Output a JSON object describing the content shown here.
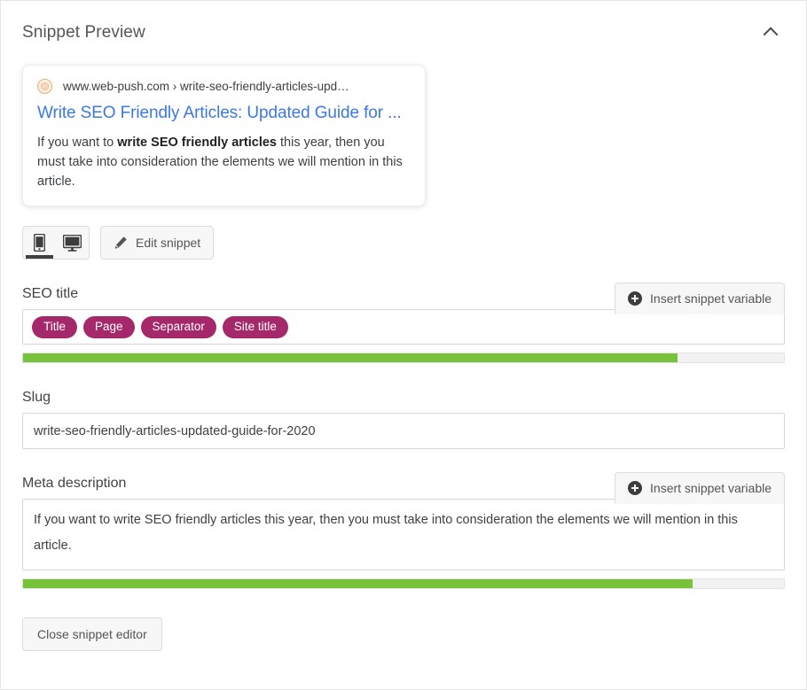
{
  "panel": {
    "title": "Snippet Preview",
    "collapse_icon": "chevron-up-icon"
  },
  "snippet_preview": {
    "favicon": "site-favicon",
    "url": "www.web-push.com › write-seo-friendly-articles-upd…",
    "title": "Write SEO Friendly Articles: Updated Guide for ...",
    "description_prefix": "If you want to ",
    "description_bold": "write SEO friendly articles",
    "description_suffix": " this year, then you must take into consideration the elements we will mention in this article."
  },
  "controls": {
    "device_toggle": {
      "mobile": {
        "icon": "mobile-phone-icon",
        "selected": true
      },
      "desktop": {
        "icon": "desktop-monitor-icon",
        "selected": false
      }
    },
    "edit_snippet": {
      "icon": "pencil-icon",
      "label": "Edit snippet"
    }
  },
  "seo_title": {
    "label": "SEO title",
    "insert_variable_label": "Insert snippet variable",
    "insert_variable_icon": "plus-circle-icon",
    "chips": [
      "Title",
      "Page",
      "Separator",
      "Site title"
    ],
    "progress_percent": 86,
    "progress_color": "#77c13b"
  },
  "slug": {
    "label": "Slug",
    "value": "write-seo-friendly-articles-updated-guide-for-2020",
    "placeholder": "write-seo-friendly-articles-updated-guide-for-2020"
  },
  "meta_description": {
    "label": "Meta description",
    "insert_variable_label": "Insert snippet variable",
    "insert_variable_icon": "plus-circle-icon",
    "value": "If you want to write SEO friendly articles this year, then you must take into consideration the elements we will mention in this article.",
    "progress_percent": 88,
    "progress_color": "#77c13b"
  },
  "footer": {
    "close_label": "Close snippet editor"
  },
  "colors": {
    "chip": "#a4286a",
    "link": "#3b78e7",
    "progress_good": "#77c13b",
    "panel_border": "#e5e5e5"
  }
}
